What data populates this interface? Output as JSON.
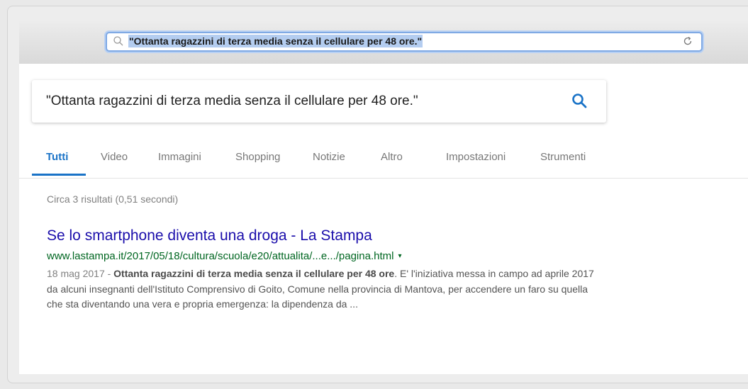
{
  "browser": {
    "address_text": "\"Ottanta ragazzini di terza media senza il cellulare per 48 ore.\""
  },
  "search": {
    "query": "\"Ottanta ragazzini di terza media senza il cellulare per 48 ore.\""
  },
  "tabs": [
    {
      "label": "Tutti"
    },
    {
      "label": "Video"
    },
    {
      "label": "Immagini"
    },
    {
      "label": "Shopping"
    },
    {
      "label": "Notizie"
    },
    {
      "label": "Altro"
    },
    {
      "label": "Impostazioni"
    },
    {
      "label": "Strumenti"
    }
  ],
  "stats": "Circa 3 risultati (0,51 secondi)",
  "result": {
    "title": "Se lo smartphone diventa una droga - La Stampa",
    "url": "www.lastampa.it/2017/05/18/cultura/scuola/e20/attualita/...e.../pagina.html",
    "arrow": "▾",
    "date": "18 mag 2017 - ",
    "bold": "Ottanta ragazzini di terza media senza il cellulare per 48 ore",
    "rest": ". E' l'iniziativa messa in campo ad aprile 2017 da alcuni insegnanti dell'Istituto Comprensivo di Goito, Comune nella provincia di Mantova, per accendere un faro su quella che sta diventando una vera e propria emergenza: la dipendenza da ..."
  },
  "colors": {
    "accent": "#1a73c7",
    "link": "#1a0dab",
    "url": "#006621"
  }
}
